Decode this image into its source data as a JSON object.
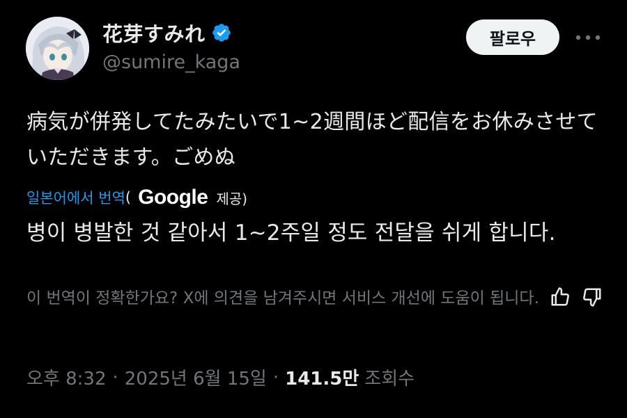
{
  "author": {
    "display_name": "花芽すみれ",
    "handle": "@sumire_kaga",
    "verified_icon": "verified-badge-icon",
    "avatar": "avatar-image"
  },
  "follow_label": "팔로우",
  "more_icon": "more-horizontal-icon",
  "tweet": {
    "text": "病気が併発してたみたいで1~2週間ほど配信をお休みさせていただきます。ごめぬ"
  },
  "translation": {
    "translated_from": "일본어에서 번역",
    "open_paren": "(",
    "provider": "Google",
    "provided": "제공)",
    "text": "병이 병발한 것 같아서 1~2주일 정도 전달을 쉬게 합니다."
  },
  "feedback": {
    "text": "이 번역이 정확한가요? X에 의견을 남겨주시면 서비스 개선에 도움이 됩니다.",
    "thumbs_up_icon": "thumbs-up-icon",
    "thumbs_down_icon": "thumbs-down-icon"
  },
  "meta": {
    "time": "오후 8:32",
    "separator": "·",
    "date": "2025년 6월 15일",
    "views_count": "141.5만",
    "views_label": "조회수"
  },
  "colors": {
    "background": "#000000",
    "text": "#e7e9ea",
    "secondary": "#71767b",
    "link": "#1d9bf0",
    "verified": "#1d9bf0",
    "button_bg": "#eff3f4"
  }
}
